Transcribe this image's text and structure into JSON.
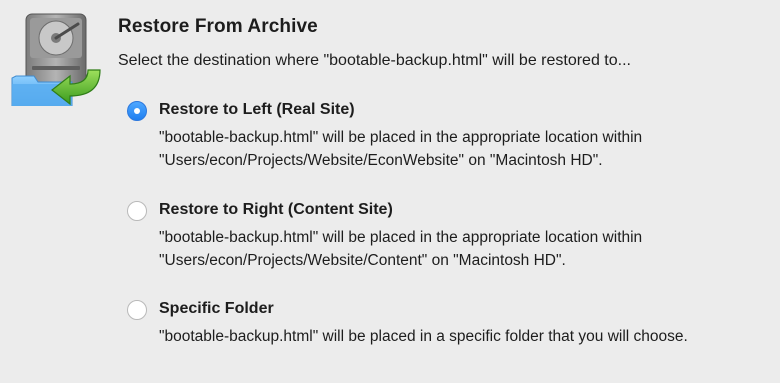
{
  "dialog": {
    "title": "Restore From Archive",
    "subtitle": "Select the destination where \"bootable-backup.html\" will be restored to...",
    "icon": "hard-drive-restore-icon"
  },
  "options": [
    {
      "label": "Restore to Left (Real Site)",
      "selected": true,
      "desc_line1": "\"bootable-backup.html\" will be placed in the appropriate location within",
      "desc_line2": "\"Users/econ/Projects/Website/EconWebsite\" on \"Macintosh HD\"."
    },
    {
      "label": "Restore to Right (Content Site)",
      "selected": false,
      "desc_line1": "\"bootable-backup.html\" will be placed in the appropriate location within",
      "desc_line2": "\"Users/econ/Projects/Website/Content\" on \"Macintosh HD\"."
    },
    {
      "label": "Specific Folder",
      "selected": false,
      "desc_line1": "\"bootable-backup.html\" will be placed in a specific folder that you will choose."
    }
  ],
  "colors": {
    "background": "#ececec",
    "radio_selected": "#1f7ff0",
    "folder_blue": "#5aaef0",
    "arrow_green": "#4fae2c"
  }
}
